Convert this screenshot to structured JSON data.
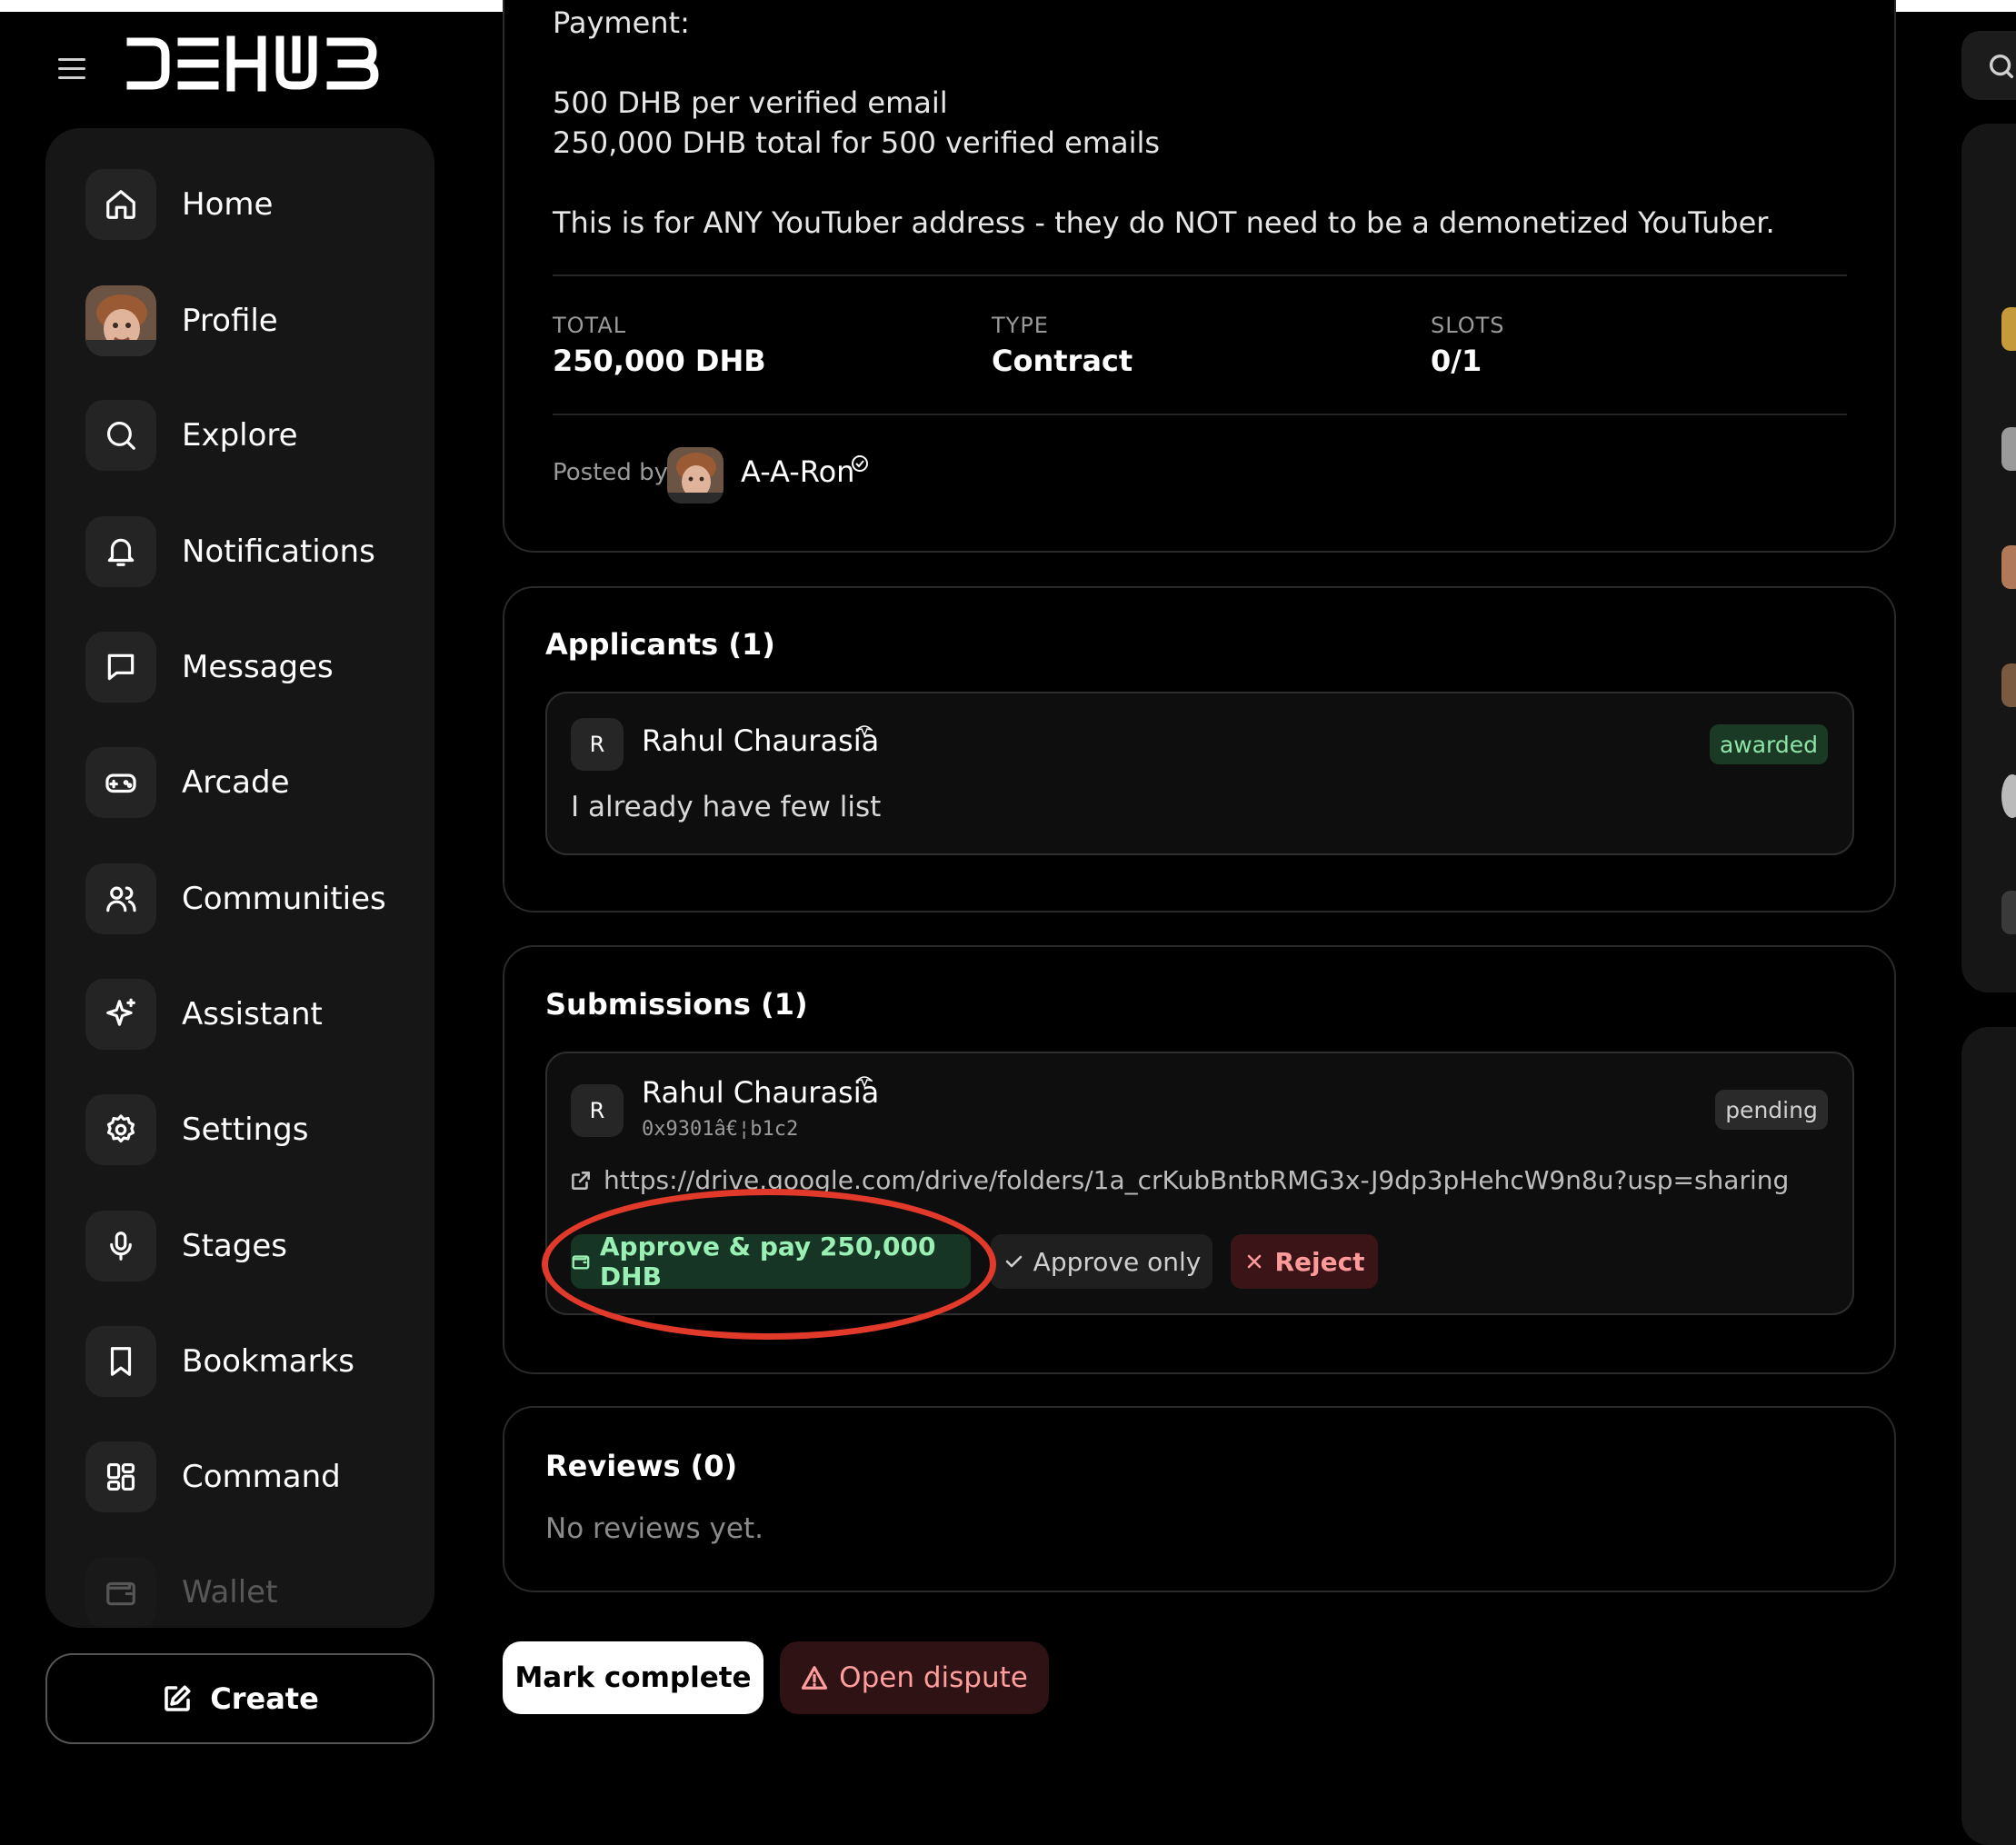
{
  "brand": {
    "logo_text": "DEHUB"
  },
  "sidebar": {
    "items": [
      {
        "label": "Home",
        "icon": "home-icon"
      },
      {
        "label": "Profile",
        "icon": "avatar"
      },
      {
        "label": "Explore",
        "icon": "search-icon"
      },
      {
        "label": "Notifications",
        "icon": "bell-icon"
      },
      {
        "label": "Messages",
        "icon": "message-icon"
      },
      {
        "label": "Arcade",
        "icon": "gamepad-icon"
      },
      {
        "label": "Communities",
        "icon": "users-icon"
      },
      {
        "label": "Assistant",
        "icon": "sparkle-icon"
      },
      {
        "label": "Settings",
        "icon": "gear-icon"
      },
      {
        "label": "Stages",
        "icon": "microphone-icon"
      },
      {
        "label": "Bookmarks",
        "icon": "bookmark-icon"
      },
      {
        "label": "Command",
        "icon": "grid-icon"
      },
      {
        "label": "Wallet",
        "icon": "wallet-icon"
      }
    ],
    "create_label": "Create"
  },
  "bounty": {
    "payment_heading": "Payment:",
    "payment_line1": "500 DHB per verified email",
    "payment_line2": "250,000 DHB total for 500 verified emails",
    "note": "This is for ANY YouTuber address - they do NOT need to be a demonetized YouTuber.",
    "stats": {
      "total_label": "TOTAL",
      "total_value": "250,000 DHB",
      "type_label": "TYPE",
      "type_value": "Contract",
      "slots_label": "SLOTS",
      "slots_value": "0/1"
    },
    "posted_by_label": "Posted by",
    "poster_name": "A-A-Ron"
  },
  "applicants": {
    "title": "Applicants (1)",
    "items": [
      {
        "initial": "R",
        "name": "Rahul Chaurasia",
        "status": "awarded",
        "message": "I already have few list"
      }
    ]
  },
  "submissions": {
    "title": "Submissions (1)",
    "items": [
      {
        "initial": "R",
        "name": "Rahul Chaurasia",
        "wallet": "0x9301â€¦b1c2",
        "status": "pending",
        "link": "https://drive.google.com/drive/folders/1a_crKubBntbRMG3x-J9dp3pHehcW9n8u?usp=sharing",
        "approve_pay_label": "Approve & pay 250,000 DHB",
        "approve_only_label": "Approve only",
        "reject_label": "Reject"
      }
    ]
  },
  "reviews": {
    "title": "Reviews (0)",
    "empty_text": "No reviews yet."
  },
  "actions": {
    "mark_complete_label": "Mark complete",
    "open_dispute_label": "Open dispute"
  },
  "colors": {
    "background": "#000000",
    "panel": "#161616",
    "success_bg": "#173524",
    "success_text": "#9af0b4",
    "danger_bg": "#3a1416",
    "danger_text": "#ff9a9a",
    "highlight_ring": "#e23a2a"
  }
}
